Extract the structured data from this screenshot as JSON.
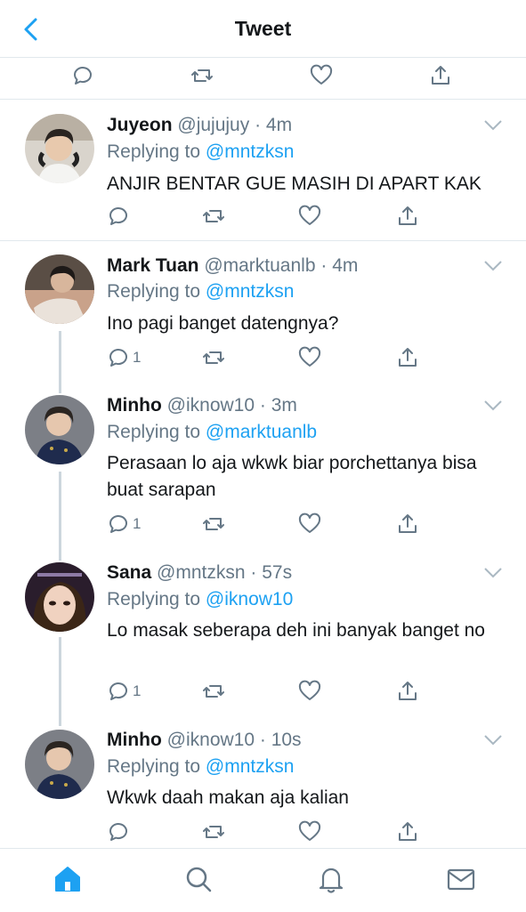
{
  "header": {
    "title": "Tweet"
  },
  "tweets": [
    {
      "name": "Juyeon",
      "handle": "@jujujuy",
      "time": "4m",
      "replying_label": "Replying to",
      "replying_to": "@mntzksn",
      "text": "ANJIR BENTAR GUE MASIH DI APART KAK",
      "reply_count": ""
    },
    {
      "name": "Mark Tuan",
      "handle": "@marktuanlb",
      "time": "4m",
      "replying_label": "Replying to",
      "replying_to": "@mntzksn",
      "text": "Ino pagi banget datengnya?",
      "reply_count": "1"
    },
    {
      "name": "Minho",
      "handle": "@iknow10",
      "time": "3m",
      "replying_label": "Replying to",
      "replying_to": "@marktuanlb",
      "text": "Perasaan lo aja wkwk biar porchettanya bisa buat sarapan",
      "reply_count": "1"
    },
    {
      "name": "Sana",
      "handle": "@mntzksn",
      "time": "57s",
      "replying_label": "Replying to",
      "replying_to": "@iknow10",
      "text": "Lo masak seberapa deh ini banyak banget no",
      "reply_count": "1"
    },
    {
      "name": "Minho",
      "handle": "@iknow10",
      "time": "10s",
      "replying_label": "Replying to",
      "replying_to": "@mntzksn",
      "text": "Wkwk daah makan aja kalian",
      "reply_count": ""
    }
  ],
  "colors": {
    "accent": "#1da1f2",
    "secondary_text": "#657786",
    "primary_text": "#14171a",
    "divider": "#e1e8ed"
  },
  "icons": [
    "back-chevron-icon",
    "reply-icon",
    "retweet-icon",
    "like-icon",
    "share-icon",
    "caret-down-icon",
    "home-icon",
    "search-icon",
    "notifications-icon",
    "messages-icon"
  ]
}
